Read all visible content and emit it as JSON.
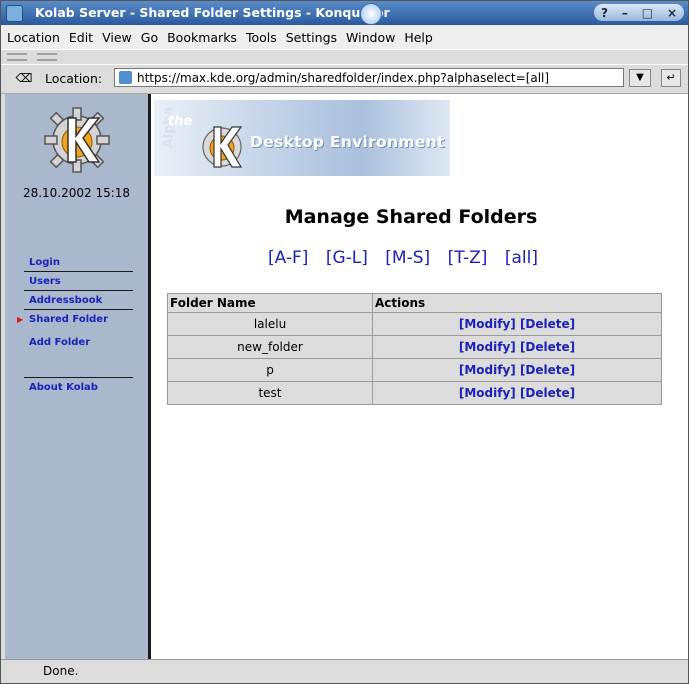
{
  "window": {
    "title": "Kolab Server - Shared Folder Settings - Konqueror",
    "controls": [
      "?",
      "–",
      "□",
      "×"
    ]
  },
  "menu": [
    "Location",
    "Edit",
    "View",
    "Go",
    "Bookmarks",
    "Tools",
    "Settings",
    "Window",
    "Help"
  ],
  "location": {
    "label": "Location:",
    "url": "https://max.kde.org/admin/sharedfolder/index.php?alphaselect=[all]"
  },
  "sidebar": {
    "datetime": "28.10.2002 15:18",
    "items": [
      {
        "label": "Login"
      },
      {
        "label": "Users"
      },
      {
        "label": "Addressbook"
      },
      {
        "label": "Shared Folder",
        "active": true
      },
      {
        "label": "Add Folder"
      },
      {
        "label": "About Kolab"
      }
    ]
  },
  "banner": {
    "alpha": "Alpha",
    "the": "the",
    "text": "Desktop Environment"
  },
  "main": {
    "heading": "Manage Shared Folders",
    "alpha_links": [
      "[A-F]",
      "[G-L]",
      "[M-S]",
      "[T-Z]",
      "[all]"
    ],
    "table": {
      "headers": [
        "Folder Name",
        "Actions"
      ],
      "rows": [
        {
          "name": "lalelu",
          "modify": "[Modify]",
          "delete": "[Delete]"
        },
        {
          "name": "new_folder",
          "modify": "[Modify]",
          "delete": "[Delete]"
        },
        {
          "name": "p",
          "modify": "[Modify]",
          "delete": "[Delete]"
        },
        {
          "name": "test",
          "modify": "[Modify]",
          "delete": "[Delete]"
        }
      ]
    }
  },
  "status": "Done."
}
